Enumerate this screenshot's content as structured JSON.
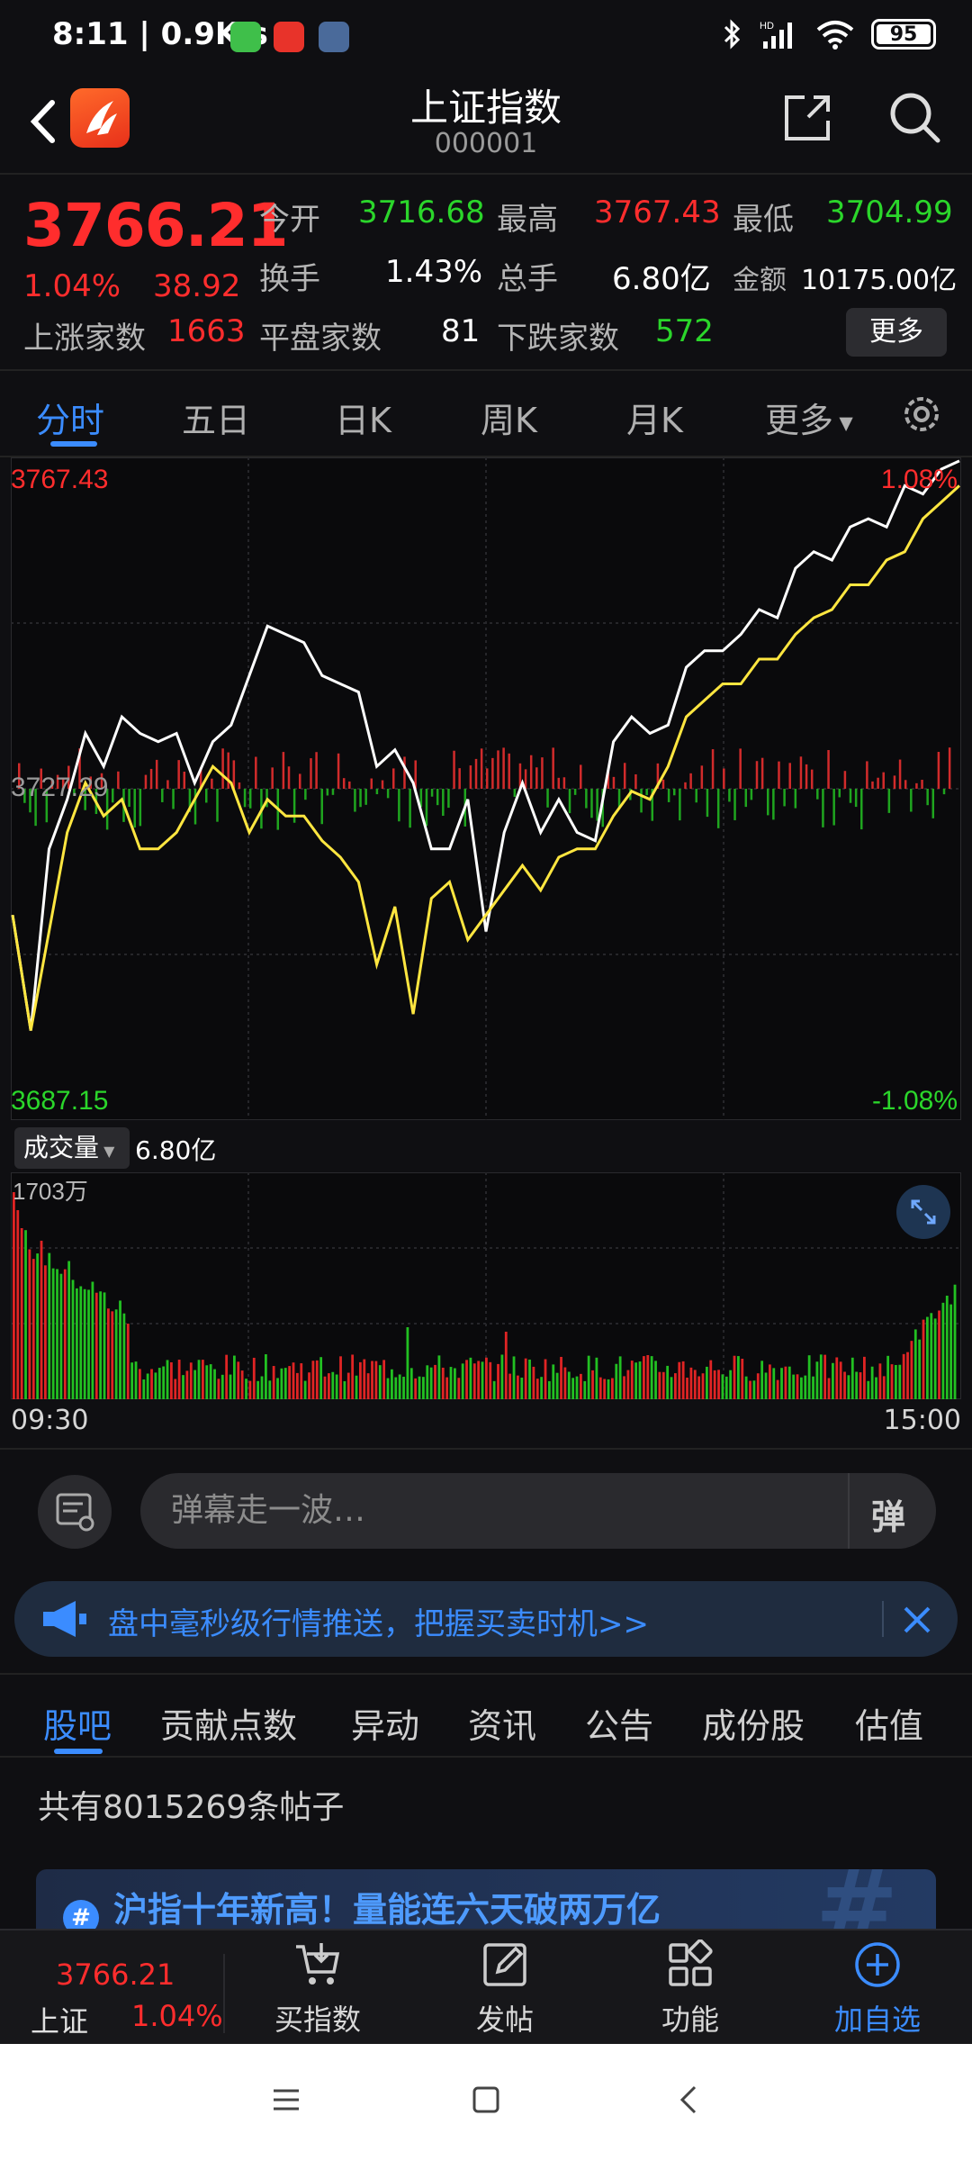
{
  "status": {
    "time": "8:11",
    "speed": "0.9K/s",
    "battery": "95",
    "network": "HD"
  },
  "header": {
    "title": "上证指数",
    "code": "000001"
  },
  "quote": {
    "price": "3766.21",
    "change_pct": "1.04%",
    "change_val": "38.92",
    "open_label": "今开",
    "open": "3716.68",
    "high_label": "最高",
    "high": "3767.43",
    "low_label": "最低",
    "low": "3704.99",
    "turnover_label": "换手",
    "turnover": "1.43%",
    "volume_label": "总手",
    "volume": "6.80亿",
    "amount_label": "金额",
    "amount": "10175.00亿",
    "up_label": "上涨家数",
    "up": "1663",
    "flat_label": "平盘家数",
    "flat": "81",
    "down_label": "下跌家数",
    "down": "572",
    "more": "更多"
  },
  "tabs": [
    "分时",
    "五日",
    "日K",
    "周K",
    "月K",
    "更多"
  ],
  "chart": {
    "top_price": "3767.43",
    "mid_price": "3727.29",
    "bottom_price": "3687.15",
    "top_pct": "1.08%",
    "bottom_pct": "-1.08%",
    "vol_select": "成交量",
    "vol_total": "6.80亿",
    "vol_max": "1703万",
    "time_start": "09:30",
    "time_end": "15:00"
  },
  "chart_data": {
    "type": "line",
    "ylim": [
      3687.15,
      3767.43
    ],
    "y_right_labels": [
      "1.08%",
      "-1.08%"
    ],
    "x_range": [
      "09:30",
      "15:00"
    ],
    "base": 3727.29,
    "series": [
      {
        "color": "#ffffff",
        "values": [
          3712,
          3698,
          3720,
          3726,
          3734,
          3730,
          3736,
          3734,
          3733,
          3734,
          3728,
          3733,
          3735,
          3741,
          3747,
          3746,
          3745,
          3741,
          3740,
          3739,
          3730,
          3732,
          3728,
          3720,
          3720,
          3726,
          3710,
          3722,
          3728,
          3722,
          3726,
          3722,
          3721,
          3733,
          3736,
          3734,
          3735,
          3742,
          3744,
          3744,
          3746,
          3749,
          3748,
          3754,
          3756,
          3755,
          3759,
          3760,
          3759,
          3764,
          3763,
          3766,
          3767
        ]
      },
      {
        "color": "#ffe640",
        "values": [
          3712,
          3698,
          3710,
          3722,
          3728,
          3724,
          3726,
          3720,
          3720,
          3722,
          3726,
          3730,
          3728,
          3722,
          3726,
          3724,
          3724,
          3721,
          3719,
          3716,
          3706,
          3713,
          3700,
          3714,
          3716,
          3709,
          3712,
          3715,
          3718,
          3715,
          3719,
          3720,
          3720,
          3724,
          3727,
          3726,
          3730,
          3736,
          3738,
          3740,
          3740,
          3743,
          3743,
          3746,
          3748,
          3749,
          3752,
          3752,
          3755,
          3756,
          3760,
          3762,
          3764
        ]
      }
    ]
  },
  "danmaku": {
    "placeholder": "弹幕走一波…",
    "toggle": "弹"
  },
  "promo": {
    "text": "盘中毫秒级行情推送，把握买卖时机>>"
  },
  "subtabs": [
    "股吧",
    "贡献点数",
    "异动",
    "资讯",
    "公告",
    "成份股",
    "估值"
  ],
  "post_count": "共有8015269条帖子",
  "post_card_title": "沪指十年新高！量能连六天破两万亿",
  "bottom": {
    "price": "3766.21",
    "name": "上证",
    "pct": "1.04%",
    "buy": "买指数",
    "post": "发帖",
    "func": "功能",
    "watch": "加自选"
  }
}
